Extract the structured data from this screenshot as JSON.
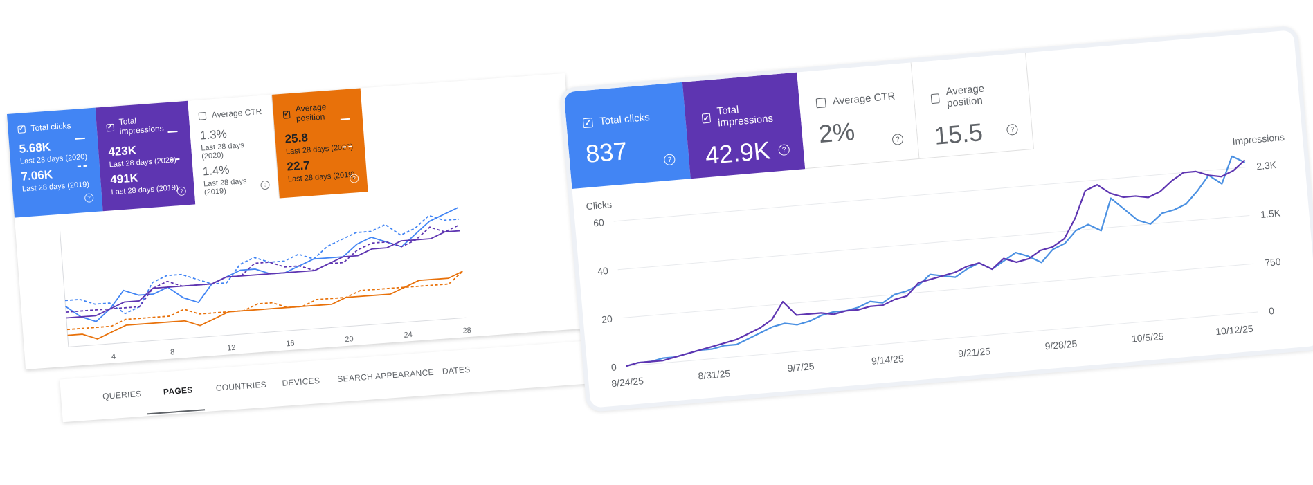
{
  "left": {
    "metrics": [
      {
        "label": "Total clicks",
        "checked": true,
        "value_2020": "5.68K",
        "period_2020": "Last 28 days (2020)",
        "value_2019": "7.06K",
        "period_2019": "Last 28 days (2019)",
        "color": "#4285f4"
      },
      {
        "label": "Total impressions",
        "checked": true,
        "value_2020": "423K",
        "period_2020": "Last 28 days (2020)",
        "value_2019": "491K",
        "period_2019": "Last 28 days (2019)",
        "color": "#5e35b1"
      },
      {
        "label": "Average CTR",
        "checked": false,
        "value_2020": "1.3%",
        "period_2020": "Last 28 days (2020)",
        "value_2019": "1.4%",
        "period_2019": "Last 28 days (2019)",
        "color": "#ffffff"
      },
      {
        "label": "Average position",
        "checked": true,
        "value_2020": "25.8",
        "period_2020": "Last 28 days (2020)",
        "value_2019": "22.7",
        "period_2019": "Last 28 days (2019)",
        "color": "#e8710a"
      }
    ],
    "help_glyph": "?",
    "tabs": [
      {
        "label": "QUERIES",
        "active": false
      },
      {
        "label": "PAGES",
        "active": true
      },
      {
        "label": "COUNTRIES",
        "active": false
      },
      {
        "label": "DEVICES",
        "active": false
      },
      {
        "label": "SEARCH APPEARANCE",
        "active": false
      },
      {
        "label": "DATES",
        "active": false
      }
    ]
  },
  "right": {
    "metrics": [
      {
        "label": "Total clicks",
        "checked": true,
        "value": "837",
        "color": "#4285f4"
      },
      {
        "label": "Total impressions",
        "checked": true,
        "value": "42.9K",
        "color": "#5e35b1"
      },
      {
        "label": "Average CTR",
        "checked": false,
        "value": "2%",
        "color": "#ffffff"
      },
      {
        "label": "Average position",
        "checked": false,
        "value": "15.5",
        "color": "#ffffff"
      }
    ],
    "help_glyph": "?"
  },
  "chart_data": [
    {
      "type": "line",
      "title": "",
      "x": [
        1,
        2,
        3,
        4,
        5,
        6,
        7,
        8,
        9,
        10,
        11,
        12,
        13,
        14,
        15,
        16,
        17,
        18,
        19,
        20,
        21,
        22,
        23,
        24,
        25,
        26,
        27,
        28
      ],
      "x_ticks": [
        "4",
        "8",
        "12",
        "16",
        "20",
        "24",
        "28"
      ],
      "series": [
        {
          "name": "Total clicks",
          "color": "#4285f4",
          "style": "solid",
          "values": [
            7,
            5,
            4,
            6,
            9,
            8,
            8,
            9,
            7,
            6,
            9,
            10,
            11,
            11,
            10,
            10,
            11,
            12,
            12,
            12,
            14,
            15,
            14,
            13,
            15,
            17,
            18,
            19
          ]
        },
        {
          "name": "Total clicks",
          "color": "#4285f4",
          "style": "dashed",
          "values": [
            8,
            8,
            7,
            7,
            5,
            6,
            10,
            11,
            11,
            10,
            9,
            9,
            12,
            13,
            12,
            12,
            13,
            12,
            14,
            15,
            16,
            16,
            17,
            15,
            16,
            18,
            17,
            17
          ]
        },
        {
          "name": "Total impressions",
          "color": "#5e35b1",
          "style": "solid",
          "values": [
            5,
            5,
            5,
            6,
            7,
            7,
            9,
            9,
            9,
            9,
            9,
            10,
            10,
            10,
            10,
            10,
            10,
            10,
            11,
            12,
            12,
            13,
            13,
            14,
            14,
            14,
            15,
            15
          ]
        },
        {
          "name": "Total impressions",
          "color": "#5e35b1",
          "style": "dashed",
          "values": [
            6,
            6,
            6,
            6,
            6,
            6,
            9,
            10,
            9,
            9,
            9,
            10,
            10,
            12,
            12,
            11,
            11,
            10,
            11,
            11,
            13,
            14,
            14,
            13,
            14,
            16,
            15,
            16
          ]
        },
        {
          "name": "Average position",
          "color": "#e8710a",
          "style": "solid",
          "values": [
            2,
            2,
            1,
            2,
            3,
            3,
            3,
            3,
            3,
            2,
            3,
            4,
            4,
            4,
            4,
            4,
            4,
            4,
            4,
            5,
            5,
            5,
            5,
            6,
            7,
            7,
            7,
            8
          ]
        },
        {
          "name": "Average position",
          "color": "#e8710a",
          "style": "dashed",
          "values": [
            3,
            3,
            3,
            3,
            4,
            4,
            4,
            4,
            5,
            4,
            4,
            4,
            4,
            5,
            5,
            4,
            4,
            5,
            5,
            5,
            6,
            6,
            6,
            6,
            6,
            6,
            6,
            8
          ]
        }
      ]
    },
    {
      "type": "line",
      "title": "",
      "x": [
        "8/24/25",
        "8/25/25",
        "8/26/25",
        "8/27/25",
        "8/28/25",
        "8/29/25",
        "8/30/25",
        "8/31/25",
        "9/1/25",
        "9/2/25",
        "9/3/25",
        "9/4/25",
        "9/5/25",
        "9/6/25",
        "9/7/25",
        "9/8/25",
        "9/9/25",
        "9/10/25",
        "9/11/25",
        "9/12/25",
        "9/13/25",
        "9/14/25",
        "9/15/25",
        "9/16/25",
        "9/17/25",
        "9/18/25",
        "9/19/25",
        "9/20/25",
        "9/21/25",
        "9/22/25",
        "9/23/25",
        "9/24/25",
        "9/25/25",
        "9/26/25",
        "9/27/25",
        "9/28/25",
        "9/29/25",
        "9/30/25",
        "10/1/25",
        "10/2/25",
        "10/3/25",
        "10/4/25",
        "10/5/25",
        "10/6/25",
        "10/7/25",
        "10/8/25",
        "10/9/25",
        "10/10/25",
        "10/11/25",
        "10/12/25",
        "10/13/25",
        "10/14/25"
      ],
      "x_ticks": [
        "8/24/25",
        "8/31/25",
        "9/7/25",
        "9/14/25",
        "9/21/25",
        "9/28/25",
        "10/5/25",
        "10/12/25"
      ],
      "y_left_label": "Clicks",
      "y_left_ticks": [
        "0",
        "20",
        "40",
        "60"
      ],
      "y_left_lim": [
        0,
        60
      ],
      "y_right_label": "Impressions",
      "y_right_ticks": [
        "0",
        "750",
        "1.5K",
        "2.3K"
      ],
      "y_right_lim": [
        0,
        2250
      ],
      "series": [
        {
          "name": "Total clicks",
          "axis": "left",
          "color": "#4a90e2",
          "values": [
            0,
            1,
            1,
            2,
            2,
            3,
            4,
            4,
            5,
            5,
            7,
            9,
            11,
            12,
            11,
            12,
            14,
            15,
            15,
            16,
            18,
            17,
            20,
            21,
            23,
            27,
            26,
            25,
            28,
            30,
            27,
            30,
            33,
            31,
            28,
            33,
            35,
            40,
            42,
            39,
            52,
            47,
            42,
            40,
            44,
            45,
            47,
            52,
            58,
            54,
            65,
            62
          ]
        },
        {
          "name": "Total impressions",
          "axis": "left",
          "color": "#5e35b1",
          "values": [
            0,
            1,
            1,
            1,
            2,
            3,
            4,
            5,
            6,
            7,
            9,
            11,
            14,
            21,
            15,
            15,
            15,
            14,
            15,
            15,
            16,
            16,
            18,
            19,
            24,
            25,
            26,
            27,
            29,
            30,
            27,
            31,
            29,
            30,
            33,
            34,
            37,
            45,
            56,
            58,
            54,
            52,
            52,
            51,
            53,
            57,
            60,
            60,
            58,
            57,
            59,
            63
          ]
        }
      ]
    }
  ]
}
